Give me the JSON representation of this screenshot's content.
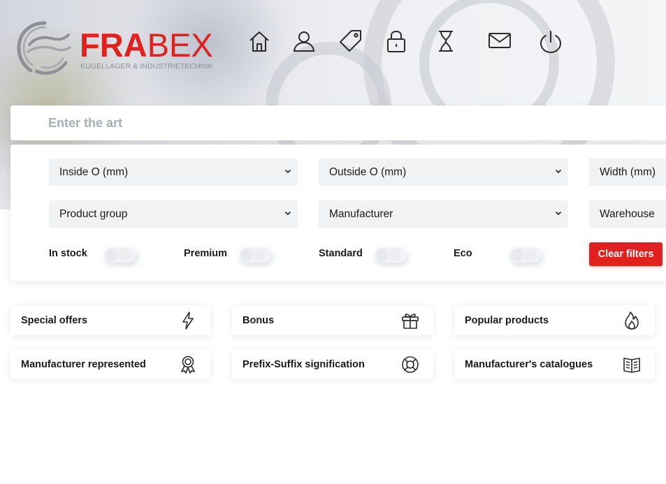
{
  "brand": {
    "name_bold": "FRA",
    "name_light": "BEX",
    "tagline": "KUGELLAGER & INDUSTRIETECHNIK",
    "accent_color": "#e0211d"
  },
  "nav": [
    {
      "name": "home-icon"
    },
    {
      "name": "user-icon"
    },
    {
      "name": "tag-icon"
    },
    {
      "name": "lock-icon"
    },
    {
      "name": "hourglass-icon"
    },
    {
      "name": "mail-icon"
    },
    {
      "name": "power-icon"
    }
  ],
  "search": {
    "placeholder": "Enter the art",
    "value": ""
  },
  "filters": {
    "selects": {
      "inside": "Inside O (mm)",
      "outside": "Outside O (mm)",
      "width": "Width (mm)",
      "product_group": "Product group",
      "manufacturer": "Manufacturer",
      "warehouse": "Warehouse"
    },
    "toggles": {
      "in_stock": "In stock",
      "premium": "Premium",
      "standard": "Standard",
      "eco": "Eco"
    },
    "clear_label": "Clear filters"
  },
  "cards": {
    "special_offers": {
      "label": "Special offers",
      "icon": "lightning-icon"
    },
    "bonus": {
      "label": "Bonus",
      "icon": "gift-icon"
    },
    "popular": {
      "label": "Popular products",
      "icon": "flame-icon"
    },
    "manufacturer_represented": {
      "label": "Manufacturer represented",
      "icon": "award-icon"
    },
    "prefix_suffix": {
      "label": "Prefix-Suffix signification",
      "icon": "lifebuoy-icon"
    },
    "catalogues": {
      "label": "Manufacturer's catalogues",
      "icon": "book-icon"
    }
  }
}
